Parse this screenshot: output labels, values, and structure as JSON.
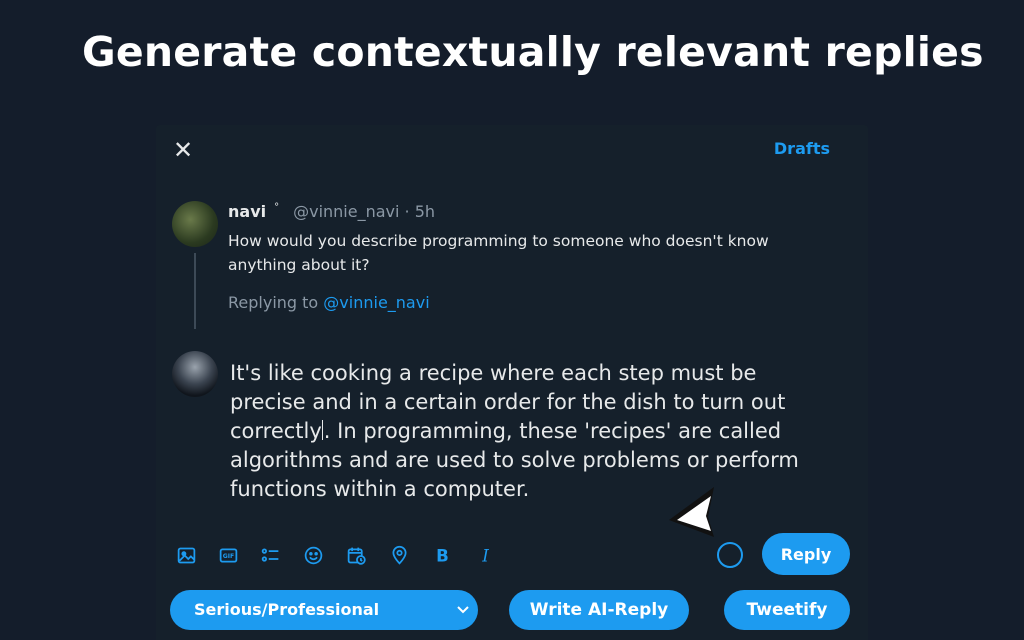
{
  "headline": "Generate contextually relevant replies",
  "modal": {
    "close_icon": "close-icon",
    "drafts_label": "Drafts"
  },
  "original_tweet": {
    "name": "navi",
    "badge": "°",
    "handle": "@vinnie_navi",
    "time": "· 5h",
    "text": "How would you describe programming to someone who doesn't know anything about it?"
  },
  "replying_to": {
    "prefix": "Replying to",
    "handle": "@vinnie_navi"
  },
  "compose": {
    "text_before_cursor": "It's like cooking a recipe where each step must be precise and in a certain order for the dish to turn out correctly",
    "text_after_cursor": ". In programming, these 'recipes' are called algorithms and are used to solve problems or perform functions within a computer."
  },
  "toolbar": {
    "icons": [
      "image-icon",
      "gif-icon",
      "poll-icon",
      "emoji-icon",
      "schedule-icon",
      "location-icon",
      "bold-icon",
      "italic-icon"
    ],
    "bold_glyph": "B",
    "italic_glyph": "I",
    "gif_glyph": "GIF"
  },
  "reply_button": "Reply",
  "ai_controls": {
    "tone_selected": "Serious/Professional",
    "write_ai_reply": "Write AI-Reply",
    "tweetify": "Tweetify"
  },
  "colors": {
    "accent": "#1d9bf0",
    "page_background": "#141d2b",
    "modal_background": "#15202b",
    "text_primary": "#e7e9ea",
    "text_secondary": "#8b98a5"
  }
}
